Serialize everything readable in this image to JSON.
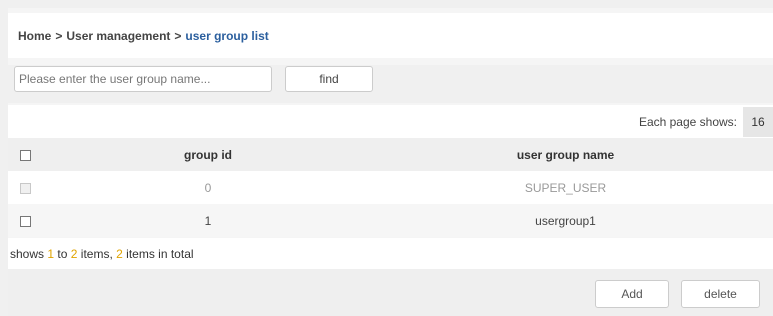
{
  "breadcrumb": {
    "home": "Home",
    "separator": ">",
    "section": "User management",
    "current": "user group list"
  },
  "search": {
    "placeholder": "Please enter the user group name...",
    "value": "",
    "find_label": "find"
  },
  "pager": {
    "label": "Each page shows:",
    "page_size": "16"
  },
  "table": {
    "columns": [
      "group id",
      "user group name"
    ],
    "rows": [
      {
        "group_id": "0",
        "name": "SUPER_USER",
        "selectable": false
      },
      {
        "group_id": "1",
        "name": "usergroup1",
        "selectable": true
      }
    ]
  },
  "summary": {
    "prefix": "shows",
    "from": "1",
    "to_word": "to",
    "to": "2",
    "items_word": "items,",
    "total": "2",
    "total_suffix": "items in total"
  },
  "actions": {
    "add_label": "Add",
    "delete_label": "delete"
  },
  "colors": {
    "link_blue": "#2b5f9e",
    "highlight_number": "#e0a400"
  }
}
